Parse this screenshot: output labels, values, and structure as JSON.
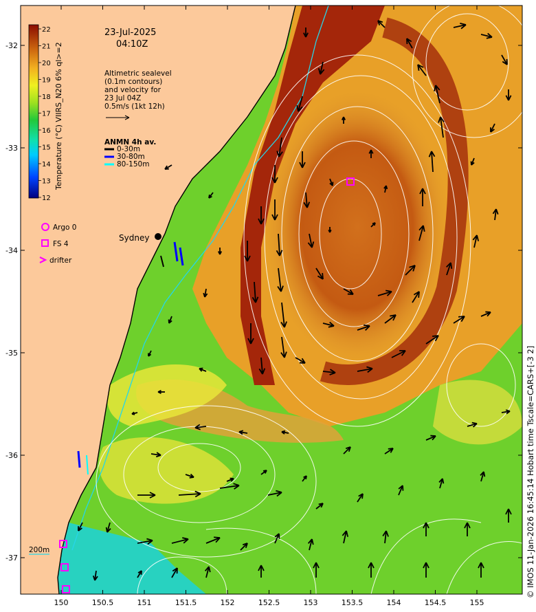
{
  "date": "23-Jul-2025",
  "time": "04:10Z",
  "altimetry_note": [
    "Altimetric sealevel",
    "(0.1m contours)",
    "and velocity for",
    "23 Jul 04Z",
    "0.5m/s (1kt 12h)"
  ],
  "anmn": {
    "title": "ANMN 4h av.",
    "items": [
      {
        "label": "0-30m",
        "color": "#000000"
      },
      {
        "label": "30-80m",
        "color": "#0000ff"
      },
      {
        "label": "80-150m",
        "color": "#00ffff"
      }
    ]
  },
  "colorbar": {
    "label": "Temperature (°C) VIIRS_N20 6% ql>=2",
    "ticks": [
      "22",
      "21",
      "20",
      "19",
      "18",
      "17",
      "16",
      "15",
      "14",
      "13",
      "12"
    ]
  },
  "legend": [
    {
      "label": "Argo 0",
      "symbol": "circle"
    },
    {
      "label": "FS 4",
      "symbol": "square"
    },
    {
      "label": "drifter",
      "symbol": "chevron"
    }
  ],
  "city": "Sydney",
  "isobath": "200m",
  "x_ticks": [
    "150",
    "150.5",
    "151",
    "151.5",
    "152",
    "152.5",
    "153",
    "153.5",
    "154",
    "154.5",
    "155"
  ],
  "y_ticks": [
    "-32",
    "-33",
    "-34",
    "-35",
    "-36",
    "-37"
  ],
  "credit": "© IMOS 11-Jan-2026 16:45:14 Hobart time Tscale=CARS+[-3 2]",
  "colors": {
    "land": "#fcc99b",
    "accent": "#ff00ff"
  }
}
